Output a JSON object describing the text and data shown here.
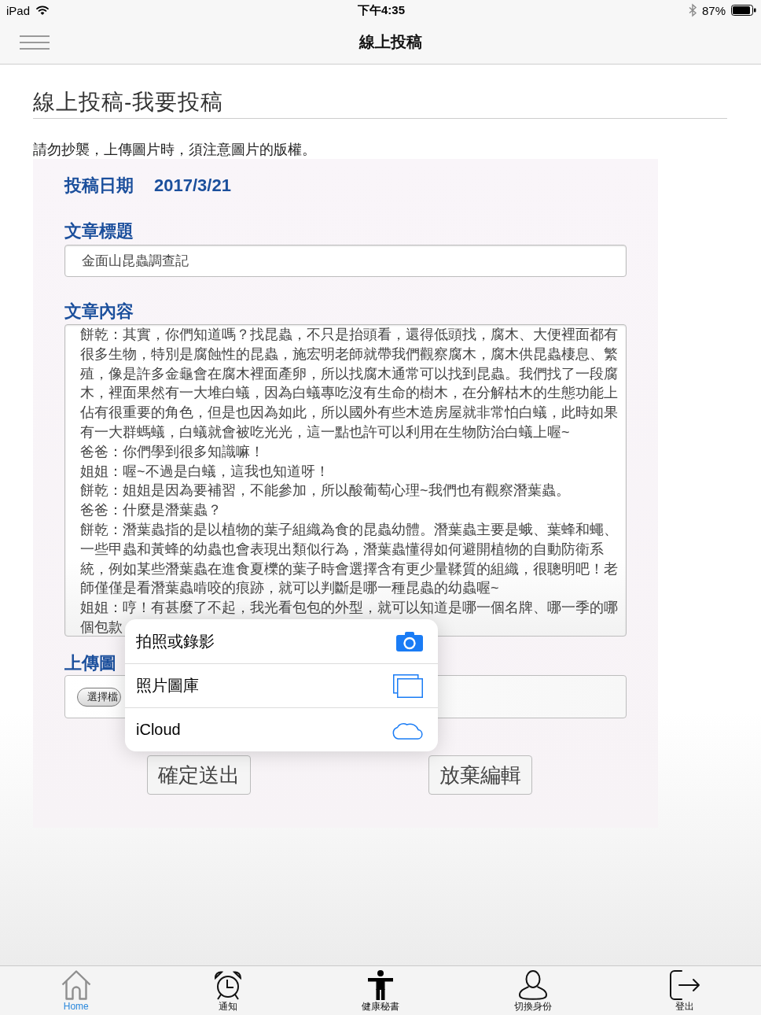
{
  "status_bar": {
    "device": "iPad",
    "time": "下午4:35",
    "battery": "87%"
  },
  "nav_bar": {
    "title": "線上投稿"
  },
  "page": {
    "heading": "線上投稿-我要投稿",
    "notice": "請勿抄襲，上傳圖片時，須注意圖片的版權。"
  },
  "form": {
    "date_label": "投稿日期",
    "date": "2017/3/21",
    "title_label": "文章標題",
    "title_value": "金面山昆蟲調查記",
    "content_label": "文章內容",
    "content_paragraphs": [
      "餅乾：其實，你們知道嗎？找昆蟲，不只是抬頭看，還得低頭找，腐木、大便裡面都有很多生物，特別是腐蝕性的昆蟲，施宏明老師就帶我們觀察腐木，腐木供昆蟲棲息、繁殖，像是許多金龜會在腐木裡面產卵，所以找腐木通常可以找到昆蟲。我們找了一段腐木，裡面果然有一大堆白蟻，因為白蟻專吃沒有生命的樹木，在分解枯木的生態功能上佔有很重要的角色，但是也因為如此，所以國外有些木造房屋就非常怕白蟻，此時如果有一大群螞蟻，白蟻就會被吃光光，這一點也許可以利用在生物防治白蟻上喔~",
      "爸爸：你們學到很多知識嘛！",
      "姐姐：喔~不過是白蟻，這我也知道呀！",
      "餅乾：姐姐是因為要補習，不能參加，所以酸葡萄心理~我們也有觀察潛葉蟲。",
      "爸爸：什麼是潛葉蟲？",
      "餅乾：潛葉蟲指的是以植物的葉子組織為食的昆蟲幼體。潛葉蟲主要是蛾、葉蜂和蠅、一些甲蟲和黃蜂的幼蟲也會表現出類似行為，潛葉蟲懂得如何避開植物的自動防衛系統，例如某些潛葉蟲在進食夏櫟的葉子時會選擇含有更少量鞣質的組織，很聰明吧！老師僅僅是看潛葉蟲啃咬的痕跡，就可以判斷是哪一種昆蟲的幼蟲喔~",
      "姐姐：哼！有甚麼了不起，我光看包包的外型，就可以知道是哪一個名牌、哪一季的哪個包款"
    ],
    "upload_label": "上傳圖",
    "file_button": "選擇檔",
    "buttons": [
      "確定送出",
      "放棄編輯"
    ]
  },
  "popover": {
    "items": [
      {
        "label": "拍照或錄影",
        "kind": "camera"
      },
      {
        "label": "照片圖庫",
        "kind": "library"
      },
      {
        "label": "iCloud",
        "kind": "cloud"
      }
    ]
  },
  "tab_bar": {
    "items": [
      {
        "label": "Home",
        "kind": "home",
        "selected": true
      },
      {
        "label": "通知",
        "kind": "alarm",
        "selected": false
      },
      {
        "label": "健康秘書",
        "kind": "figure",
        "selected": false
      },
      {
        "label": "切換身份",
        "kind": "person",
        "selected": false
      },
      {
        "label": "登出",
        "kind": "exit",
        "selected": false
      }
    ]
  }
}
